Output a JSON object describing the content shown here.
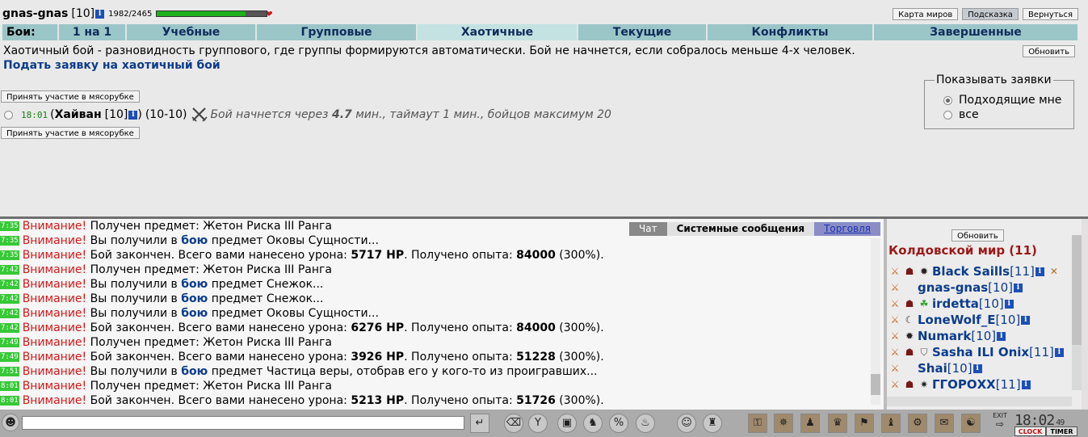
{
  "player": {
    "name": "gnas-gnas",
    "level": "[10]",
    "info_icon": "i",
    "hp_text": "1982/2465",
    "hp_fraction": 0.804
  },
  "header_buttons": {
    "world_map": "Карта миров",
    "hint": "Подсказка",
    "back": "Вернуться"
  },
  "tabs": {
    "label": "Бои:",
    "items": [
      "1 на 1",
      "Учебные",
      "Групповые",
      "Хаотичные",
      "Текущие",
      "Конфликты",
      "Завершенные"
    ],
    "active": "Хаотичные"
  },
  "description": "Хаотичный бой - разновидность группового, где группы формируются автоматически. Бой не начнется, если собралось меньше 4-х человек.",
  "refresh_label": "Обновить",
  "submit_link": "Подать заявку на хаотичный бой",
  "join_label": "Принять участие в мясорубке",
  "fight": {
    "time": "18:01",
    "open_paren": "(",
    "leader": "Хайван",
    "leader_level": "[10]",
    "close_paren": ")",
    "range": "(10-10)",
    "note_prefix": "Бой начнется через",
    "note_value": "4.7",
    "note_suffix": "мин., таймаут 1 мин., бойцов максимум 20"
  },
  "filter": {
    "legend": "Показывать заявки",
    "options": [
      "Подходящие мне",
      "все"
    ],
    "selected": "Подходящие мне"
  },
  "chat_tabs": {
    "chat": "Чат",
    "system": "Системные сообщения",
    "trade": "Торговля"
  },
  "log": [
    {
      "time": "7:35",
      "warn": "Внимание!",
      "text": "Получен предмет: Жетон Риска III Ранга"
    },
    {
      "time": "7:35",
      "warn": "Внимание!",
      "pre": "Вы получили в",
      "fight": "бою",
      "post": "предмет Оковы Сущности..."
    },
    {
      "time": "7:35",
      "warn": "Внимание!",
      "battle": true,
      "dmg_pre": "Бой закончен. Всего вами нанесено урона:",
      "dmg": "5717 HP",
      "exp_pre": ". Получено опыта:",
      "exp": "84000",
      "pct": "(300%)."
    },
    {
      "time": "7:42",
      "warn": "Внимание!",
      "text": "Получен предмет: Жетон Риска III Ранга"
    },
    {
      "time": "7:42",
      "warn": "Внимание!",
      "pre": "Вы получили в",
      "fight": "бою",
      "post": "предмет Снежок..."
    },
    {
      "time": "7:42",
      "warn": "Внимание!",
      "pre": "Вы получили в",
      "fight": "бою",
      "post": "предмет Снежок..."
    },
    {
      "time": "7:42",
      "warn": "Внимание!",
      "pre": "Вы получили в",
      "fight": "бою",
      "post": "предмет Оковы Сущности..."
    },
    {
      "time": "7:42",
      "warn": "Внимание!",
      "battle": true,
      "dmg_pre": "Бой закончен. Всего вами нанесено урона:",
      "dmg": "6276 HP",
      "exp_pre": ". Получено опыта:",
      "exp": "84000",
      "pct": "(300%)."
    },
    {
      "time": "7:49",
      "warn": "Внимание!",
      "text": "Получен предмет: Жетон Риска III Ранга"
    },
    {
      "time": "7:49",
      "warn": "Внимание!",
      "battle": true,
      "dmg_pre": "Бой закончен. Всего вами нанесено урона:",
      "dmg": "3926 HP",
      "exp_pre": ". Получено опыта:",
      "exp": "51228",
      "pct": "(300%)."
    },
    {
      "time": "7:51",
      "warn": "Внимание!",
      "pre": "Вы получили в",
      "fight": "бою",
      "post": "предмет Частица веры, отобрав его у кого-то из проигравших..."
    },
    {
      "time": "8:01",
      "warn": "Внимание!",
      "text": "Получен предмет: Жетон Риска III Ранга"
    },
    {
      "time": "8:01",
      "warn": "Внимание!",
      "battle": true,
      "dmg_pre": "Бой закончен. Всего вами нанесено урона:",
      "dmg": "5213 HP",
      "exp_pre": ". Получено опыта:",
      "exp": "51726",
      "pct": "(300%)."
    }
  ],
  "side": {
    "refresh_label": "Обновить",
    "world_title": "Колдовской мир (11)",
    "users": [
      {
        "name": "Black Saills",
        "level": "[11]",
        "icons": [
          "status-icon",
          "clan-icon",
          "beast-icon"
        ],
        "extra": "crossed-swords-icon"
      },
      {
        "name": "gnas-gnas",
        "level": "[10]",
        "icons": [
          "status-icon"
        ]
      },
      {
        "name": "irdetta",
        "level": "[10]",
        "icons": [
          "status-icon",
          "clan-icon",
          "dragon-icon"
        ]
      },
      {
        "name": "LoneWolf_E",
        "level": "[10]",
        "icons": [
          "status-icon",
          "moon-icon"
        ]
      },
      {
        "name": "Numark",
        "level": "[10]",
        "icons": [
          "status-icon",
          "beast-icon"
        ]
      },
      {
        "name": "Sasha ILI Onix",
        "level": "[11]",
        "icons": [
          "status-icon",
          "clan-icon",
          "shield-icon"
        ]
      },
      {
        "name": "Shai",
        "level": "[10]",
        "icons": [
          "status-icon"
        ]
      },
      {
        "name": "ГГОРОХХ",
        "level": "[11]",
        "icons": [
          "status-icon",
          "clan-icon",
          "star-icon"
        ]
      }
    ]
  },
  "bottom": {
    "exit_label": "EXIT",
    "clock": "18:02",
    "clock_sec": "49",
    "clock_label": "CLOCK",
    "timer_label": "TIMER"
  },
  "colors": {
    "warn": "#d21818",
    "link": "#0c3c8a",
    "tab_bg": "#9ac6c8",
    "tab_active": "#c4e2e2",
    "time_bg": "#36c836"
  }
}
